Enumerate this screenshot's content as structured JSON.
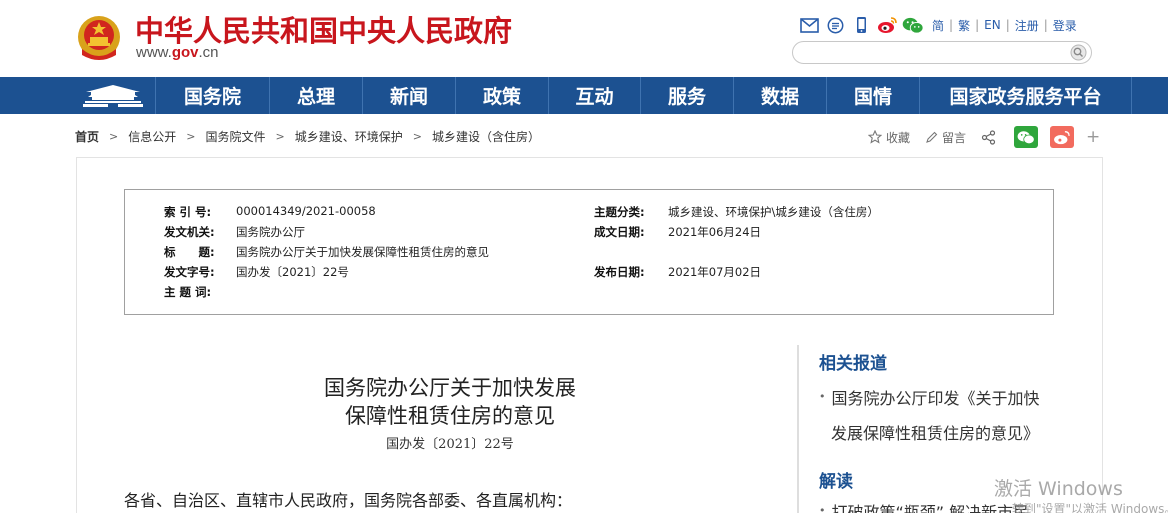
{
  "header": {
    "site_title": "中华人民共和国中央人民政府",
    "domain_prefix": "www.",
    "domain_bold": "gov",
    "domain_suffix": ".cn",
    "links": [
      "简",
      "繁",
      "EN",
      "注册",
      "登录"
    ],
    "search_placeholder": "",
    "icons": [
      "mail-icon",
      "message-icon",
      "mobile-icon",
      "weibo-icon",
      "wechat-icon"
    ]
  },
  "nav": {
    "items": [
      "国务院",
      "总理",
      "新闻",
      "政策",
      "互动",
      "服务",
      "数据",
      "国情",
      "国家政务服务平台"
    ]
  },
  "breadcrumb": {
    "items": [
      "首页",
      "信息公开",
      "国务院文件",
      "城乡建设、环境保护",
      "城乡建设（含住房）"
    ],
    "separator": ">"
  },
  "tools": {
    "favorite": "收藏",
    "comment": "留言"
  },
  "info": {
    "left": [
      {
        "label": "索 引 号:",
        "value": "000014349/2021-00058"
      },
      {
        "label": "发文机关:",
        "value": "国务院办公厅"
      },
      {
        "label": "标　　题:",
        "value": "国务院办公厅关于加快发展保障性租赁住房的意见"
      },
      {
        "label": "发文字号:",
        "value": "国办发〔2021〕22号"
      },
      {
        "label": "主 题 词:",
        "value": ""
      }
    ],
    "right": [
      {
        "label": "主题分类:",
        "value": "城乡建设、环境保护\\城乡建设（含住房）"
      },
      {
        "label": "成文日期:",
        "value": "2021年06月24日"
      },
      {
        "label": "发布日期:",
        "value": "2021年07月02日"
      }
    ]
  },
  "article": {
    "title_line1": "国务院办公厅关于加快发展",
    "title_line2": "保障性租赁住房的意见",
    "doc_number": "国办发〔2021〕22号",
    "first_line": "各省、自治区、直辖市人民政府，国务院各部委、各直属机构："
  },
  "sidebar": {
    "related_title": "相关报道",
    "related_item_line1": "国务院办公厅印发《关于加快",
    "related_item_line2": "发展保障性租赁住房的意见》",
    "interpret_title": "解读",
    "interpret_item": "打破政策“瓶颈” 解决新市民"
  },
  "watermark": {
    "line1": "激活 Windows",
    "line2": "转到\"设置\"以激活 Windows。"
  }
}
